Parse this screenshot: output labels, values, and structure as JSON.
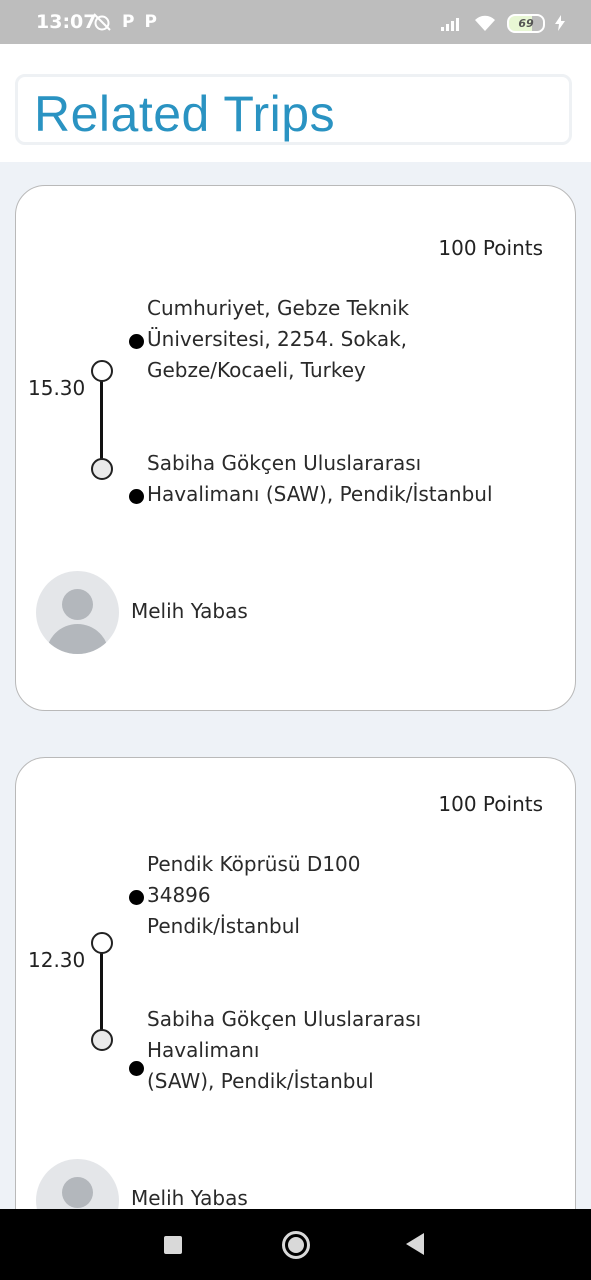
{
  "status_bar": {
    "time": "13:07",
    "left_icons": [
      "alarm-off-icon",
      "P",
      "P"
    ],
    "battery": "69",
    "right_icons": [
      "signal-icon",
      "wifi-icon",
      "battery-icon",
      "charging-icon"
    ]
  },
  "header": {
    "title": "Related Trips"
  },
  "colors": {
    "title": "#2a93c2",
    "background": "#eef2f7",
    "card_border": "#b9b9b9"
  },
  "trips": [
    {
      "points": "100 Points",
      "time": "15.30",
      "from": "Cumhuriyet, Gebze Teknik\nÜniversitesi, 2254. Sokak,\nGebze/Kocaeli, Turkey",
      "to": "Sabiha Gökçen Uluslararası\nHavalimanı (SAW), Pendik/İstanbul",
      "driver": "Melih Yabas"
    },
    {
      "points": "100 Points",
      "time": "12.30",
      "from": "Pendik Köprüsü D100\n34896\nPendik/İstanbul",
      "to": "Sabiha Gökçen Uluslararası\nHavalimanı\n (SAW), Pendik/İstanbul",
      "driver": "Melih Yabas"
    }
  ],
  "nav_bar": {
    "buttons": [
      "recents-icon",
      "home-icon",
      "back-icon"
    ]
  }
}
